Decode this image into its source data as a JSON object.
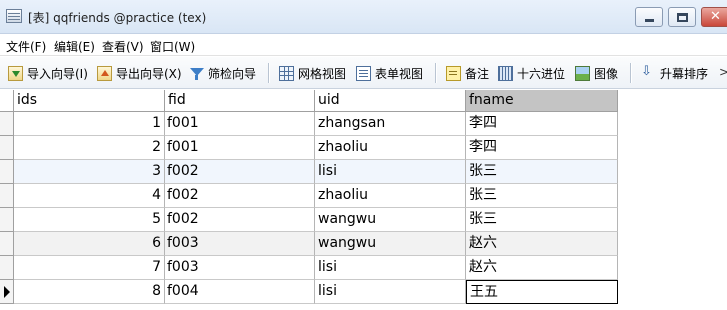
{
  "window": {
    "title": "[表] qqfriends @practice (tex)",
    "buttons": {
      "close_glyph": "✕"
    }
  },
  "menu": [
    {
      "label": "文件(F)"
    },
    {
      "label": "编辑(E)"
    },
    {
      "label": "查看(V)"
    },
    {
      "label": "窗口(W)"
    }
  ],
  "toolbar": {
    "import_wizard": {
      "label": "导入向导(I)",
      "icon": "import-icon"
    },
    "export_wizard": {
      "label": "导出向导(X)",
      "icon": "export-icon"
    },
    "filter_wizard": {
      "label": "筛检向导",
      "icon": "filter-icon"
    },
    "grid_view": {
      "label": "网格视图",
      "icon": "grid-view-icon"
    },
    "form_view": {
      "label": "表单视图",
      "icon": "form-view-icon"
    },
    "memo": {
      "label": "备注",
      "icon": "memo-icon"
    },
    "hex": {
      "label": "十六进位",
      "icon": "hex-icon"
    },
    "image": {
      "label": "图像",
      "icon": "image-icon"
    },
    "sort_asc": {
      "label": "升幕排序",
      "icon": "sort-ascending-icon"
    },
    "overflow": ">>"
  },
  "table": {
    "columns": [
      "ids",
      "fid",
      "uid",
      "fname"
    ],
    "rows": [
      {
        "ids": "1",
        "fid": "f001",
        "uid": "zhangsan",
        "fname": "李四"
      },
      {
        "ids": "2",
        "fid": "f001",
        "uid": "zhaoliu",
        "fname": "李四"
      },
      {
        "ids": "3",
        "fid": "f002",
        "uid": "lisi",
        "fname": "张三"
      },
      {
        "ids": "4",
        "fid": "f002",
        "uid": "zhaoliu",
        "fname": "张三"
      },
      {
        "ids": "5",
        "fid": "f002",
        "uid": "wangwu",
        "fname": "张三"
      },
      {
        "ids": "6",
        "fid": "f003",
        "uid": "wangwu",
        "fname": "赵六"
      },
      {
        "ids": "7",
        "fid": "f003",
        "uid": "lisi",
        "fname": "赵六"
      },
      {
        "ids": "8",
        "fid": "f004",
        "uid": "lisi",
        "fname": "王五"
      }
    ],
    "selected_column": "fname",
    "current_row": 8
  }
}
